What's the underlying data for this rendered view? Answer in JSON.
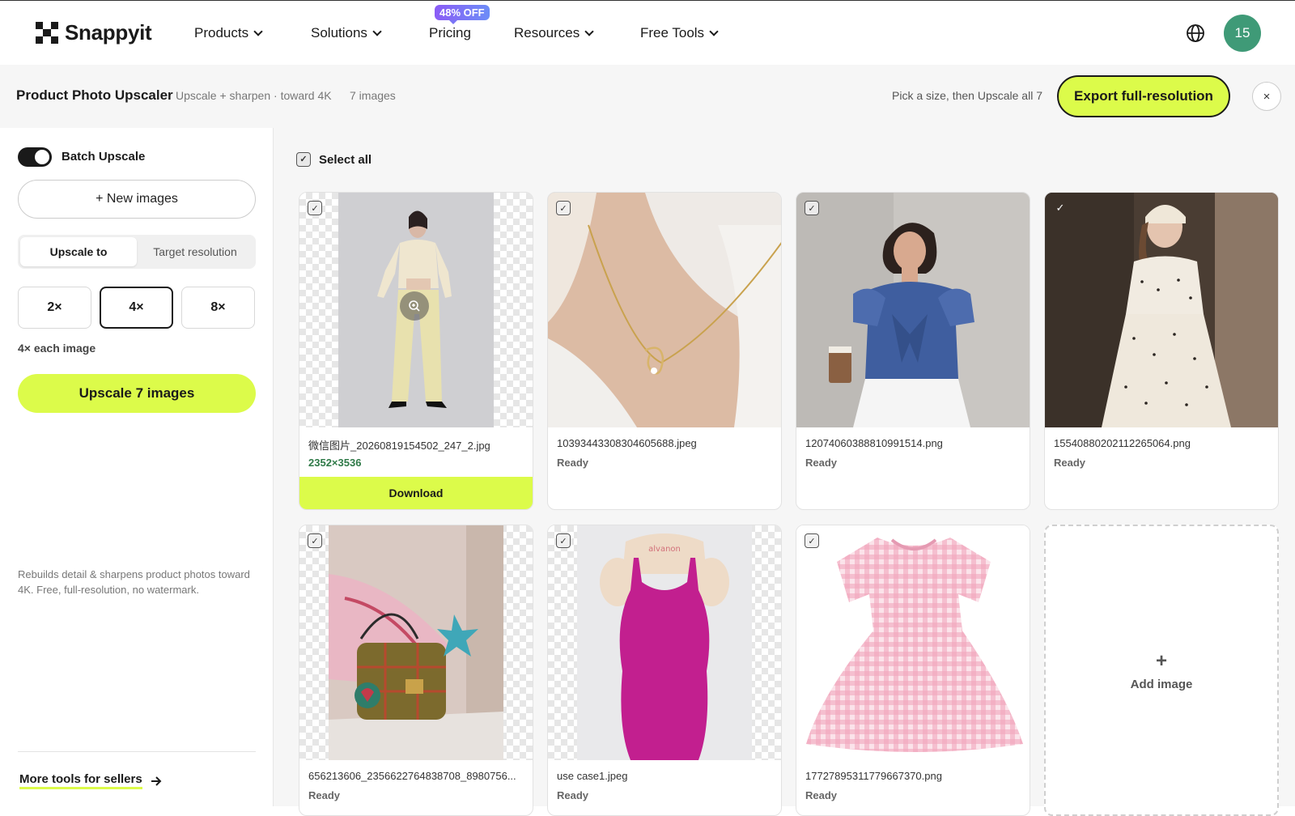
{
  "nav": {
    "brand": "Snappyit",
    "items": [
      {
        "label": "Products",
        "dropdown": true
      },
      {
        "label": "Solutions",
        "dropdown": true
      },
      {
        "label": "Pricing",
        "dropdown": false
      },
      {
        "label": "Resources",
        "dropdown": true
      },
      {
        "label": "Free Tools",
        "dropdown": true
      }
    ],
    "pricing_badge": "48% OFF",
    "avatar_text": "15",
    "globe_icon": "globe-icon"
  },
  "subheader": {
    "title": "Product Photo Upscaler",
    "description": "Upscale + sharpen · toward 4K",
    "count": "7 images",
    "hint": "Pick a size, then Upscale all 7",
    "export_label": "Export full-resolution",
    "close_label": "×"
  },
  "sidebar": {
    "toggle_label": "Batch Upscale",
    "toggle_on": true,
    "new_images_label": "+ New images",
    "segments": [
      "Upscale to",
      "Target resolution"
    ],
    "active_segment": 0,
    "scales": [
      "2×",
      "4×",
      "8×"
    ],
    "active_scale": 1,
    "each_label": "4× each image",
    "upscale_label": "Upscale 7 images",
    "note": "Rebuilds detail & sharpens product photos toward 4K. Free, full-resolution, no watermark.",
    "more_tools": "More tools for sellers"
  },
  "grid": {
    "select_all": "Select all",
    "add_image": "Add image",
    "cards": [
      {
        "name": "微信图片_20260819154502_247_2.jpg",
        "status": "2352×3536",
        "download": "Download"
      },
      {
        "name": "10393443308304605688.jpeg",
        "status": "Ready"
      },
      {
        "name": "12074060388810991514.png",
        "status": "Ready"
      },
      {
        "name": "15540880202112265064.png",
        "status": "Ready"
      },
      {
        "name": "656213606_2356622764838708_8980756...",
        "status": "Ready"
      },
      {
        "name": "use case1.jpeg",
        "status": "Ready"
      },
      {
        "name": "17727895311779667370.png",
        "status": "Ready"
      }
    ]
  },
  "colors": {
    "accent": "#dcfb4a",
    "avatar": "#3f9a77",
    "resolution_text": "#2f7a48"
  }
}
